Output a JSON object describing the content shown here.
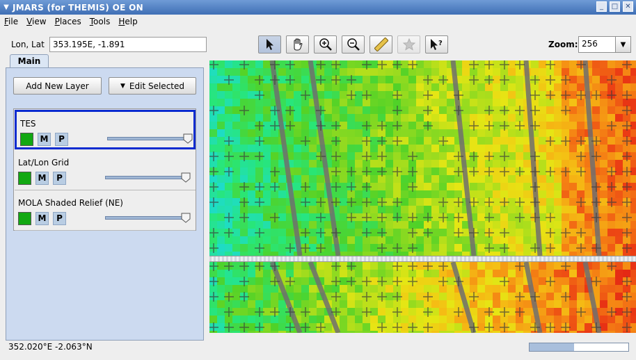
{
  "window": {
    "title": "JMARS (for THEMIS) OE ON",
    "menu_glyph": "▼",
    "minimize": "_",
    "maximize": "□",
    "close": "✕"
  },
  "menubar": {
    "items": [
      {
        "mnemonic": "F",
        "rest": "ile"
      },
      {
        "mnemonic": "V",
        "rest": "iew"
      },
      {
        "mnemonic": "P",
        "rest": "laces"
      },
      {
        "mnemonic": "T",
        "rest": "ools"
      },
      {
        "mnemonic": "H",
        "rest": "elp"
      }
    ]
  },
  "toolbar": {
    "lonlat_label": "Lon, Lat",
    "lonlat_value": "353.195E, -1.891",
    "tools": [
      "pointer-icon",
      "pan-hand-icon",
      "zoom-in-icon",
      "zoom-out-icon",
      "ruler-icon",
      "favorite-star-icon",
      "help-pointer-icon"
    ],
    "zoom_label": "Zoom:",
    "zoom_value": "256"
  },
  "panel": {
    "tab_label": "Main",
    "add_layer_label": "Add New Layer",
    "edit_selected_label": "Edit Selected",
    "layers": [
      {
        "name": "TES",
        "m": "M",
        "p": "P",
        "opacity": 1.0,
        "selected": true
      },
      {
        "name": "Lat/Lon Grid",
        "m": "M",
        "p": "P",
        "opacity": 1.0,
        "selected": false
      },
      {
        "name": "MOLA Shaded Relief (NE)",
        "m": "M",
        "p": "P",
        "opacity": 1.0,
        "selected": false
      }
    ]
  },
  "status": {
    "coords": "352.020°E   -2.063°N",
    "progress": 0.45
  },
  "colors": {
    "accent": "#0a2bd0",
    "layer_swatch": "#12a812",
    "title_bar": "#4a78bb"
  }
}
